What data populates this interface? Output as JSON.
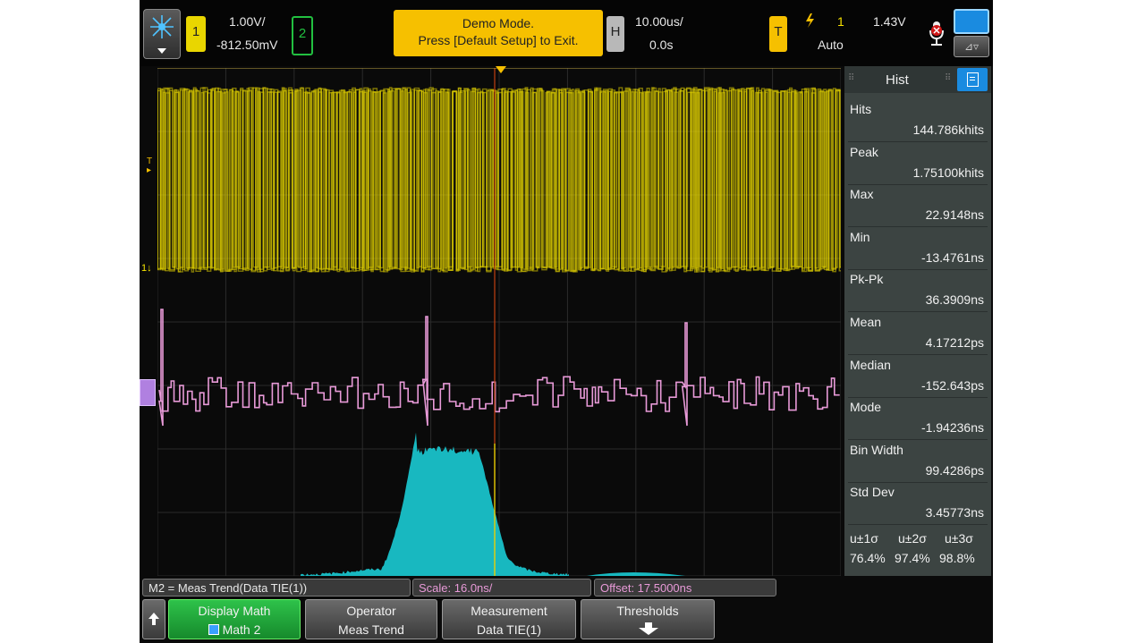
{
  "top": {
    "ch1_badge": "1",
    "ch1_scale": "1.00V/",
    "ch1_offset": "-812.50mV",
    "ch2_badge": "2",
    "demo_line1": "Demo Mode.",
    "demo_line2": "Press [Default Setup] to Exit.",
    "h_badge": "H",
    "time_scale": "10.00us/",
    "time_delay": "0.0s",
    "t_badge": "T",
    "trig_source": "1",
    "trig_level": "1.43V",
    "trig_mode": "Auto"
  },
  "markers": {
    "trigger": "T",
    "ch1": "1"
  },
  "side": {
    "title": "Hist",
    "rows": [
      {
        "label": "Hits",
        "value": "144.786khits"
      },
      {
        "label": "Peak",
        "value": "1.75100khits"
      },
      {
        "label": "Max",
        "value": "22.9148ns"
      },
      {
        "label": "Min",
        "value": "-13.4761ns"
      },
      {
        "label": "Pk-Pk",
        "value": "36.3909ns"
      },
      {
        "label": "Mean",
        "value": "4.17212ps"
      },
      {
        "label": "Median",
        "value": "-152.643ps"
      },
      {
        "label": "Mode",
        "value": "-1.94236ns"
      },
      {
        "label": "Bin Width",
        "value": "99.4286ps"
      },
      {
        "label": "Std Dev",
        "value": "3.45773ns"
      }
    ],
    "sigma_headers": [
      "u±1σ",
      "u±2σ",
      "u±3σ"
    ],
    "sigma_values": [
      "76.4%",
      "97.4%",
      "98.8%"
    ]
  },
  "bottom": {
    "math_def": "M2 = Meas Trend(Data TIE(1))",
    "scale": "Scale: 16.0ns/",
    "offset": "Offset: 17.5000ns",
    "soft1_l1": "Display Math",
    "soft1_l2": "Math 2",
    "soft2_l1": "Operator",
    "soft2_l2": "Meas Trend",
    "soft3_l1": "Measurement",
    "soft3_l2": "Data TIE(1)",
    "soft4_l1": "Thresholds"
  },
  "colors": {
    "ch1": "#f5e400",
    "math": "#e89ad8",
    "histogram": "#18b8c0",
    "green": "#22a83c",
    "demo": "#f6c000"
  },
  "icons": [
    "keysight-logo-icon",
    "down-arrow-icon",
    "trigger-edge-icon",
    "microphone-off-icon",
    "touch-icon",
    "menu-icon",
    "up-arrow-icon",
    "grip-icon"
  ]
}
